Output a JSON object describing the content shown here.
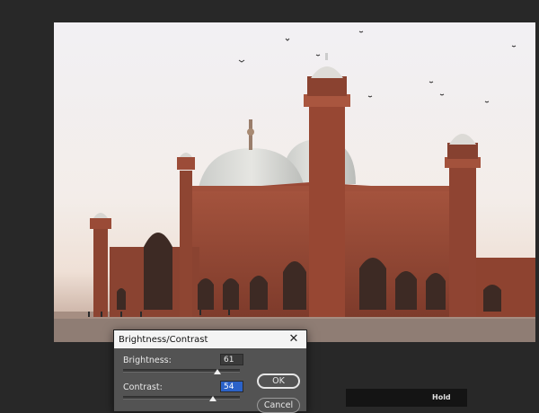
{
  "photo": {
    "alt": "Badshahi Mosque photograph"
  },
  "dialog": {
    "title": "Brightness/Contrast",
    "close_icon": "close-icon",
    "brightness_label": "Brightness:",
    "brightness_value": "61",
    "brightness_level": 0.61,
    "contrast_label": "Contrast:",
    "contrast_value": "54",
    "contrast_level": 0.54,
    "ok_label": "OK",
    "cancel_label": "Cancel"
  },
  "hold": {
    "label": "Hold"
  },
  "colors": {
    "workspace": "#282828",
    "dialog_bg": "#535353",
    "titlebar": "#f4f4f4",
    "sandstone": "#9c4a36",
    "dome": "#dcdcd8"
  }
}
